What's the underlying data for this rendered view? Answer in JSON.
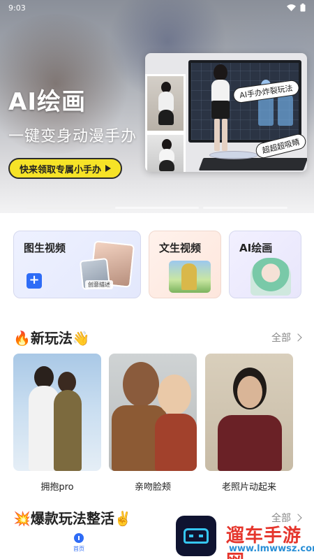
{
  "status_bar": {
    "time": "9:03"
  },
  "hero": {
    "title": "AI绘画",
    "subtitle": "一键变身动漫手办",
    "cta_label": "快来领取专属小手办",
    "tag_1": "AI手办炸裂玩法",
    "tag_2": "超超超吸睛"
  },
  "features": [
    {
      "title": "图生视频",
      "caption": "创意描述"
    },
    {
      "title": "文生视频"
    },
    {
      "title": "AI绘画"
    }
  ],
  "section_new": {
    "title": "🔥新玩法👋",
    "more_label": "全部",
    "cards": [
      {
        "label": "拥抱pro"
      },
      {
        "label": "亲吻脸颊"
      },
      {
        "label": "老照片动起来"
      }
    ]
  },
  "section_hot": {
    "title": "💥爆款玩法整活✌️",
    "more_label": "全部"
  },
  "bottom_nav": {
    "home_label": "首页"
  },
  "watermark": {
    "brand": "遛车手游网",
    "url": "www.lmwwsz.com"
  },
  "colors": {
    "accent": "#2e6cf6",
    "cta": "#f6e327"
  }
}
